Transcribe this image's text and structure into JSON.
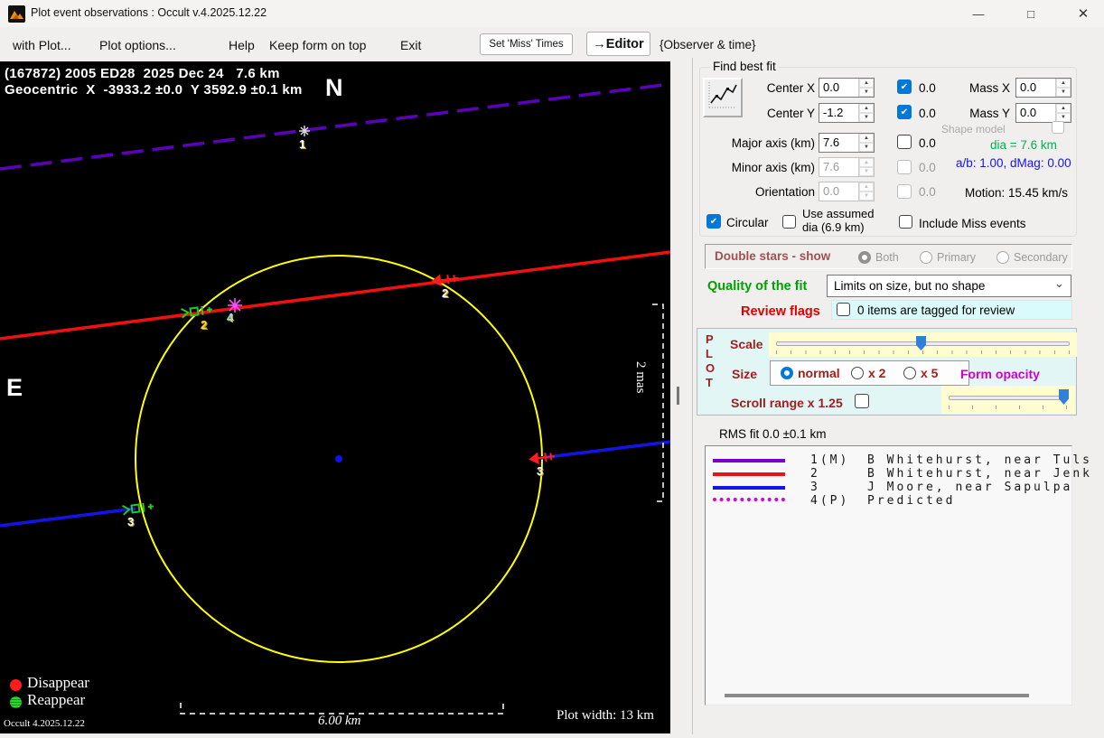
{
  "window": {
    "title": "Plot event observations : Occult v.4.2025.12.22"
  },
  "icons": {
    "minimize": "—",
    "maximize": "□",
    "close": "✕",
    "help": "?",
    "check": "✔",
    "spin_up": "▲",
    "spin_down": "▼",
    "dropdown": "⌄"
  },
  "menubar": {
    "with_plot": "with Plot...",
    "plot_options": "Plot options...",
    "help": "Help",
    "keep_on_top": "Keep form on top",
    "exit": "Exit",
    "set_miss_times": "Set 'Miss' Times",
    "editor": "→Editor",
    "observer_time": "{Observer & time}"
  },
  "plot": {
    "title": "(167872) 2005 ED28  2025 Dec 24   7.6 km",
    "subtitle": "Geocentric  X  -3933.2 ±0.0  Y 3592.9 ±0.1 km",
    "north": "N",
    "east": "E",
    "mas_bracket": "2 mas",
    "scalebar": "6.00 km",
    "plot_width": "Plot width: 13 km",
    "disappear": "Disappear",
    "reappear": "Reappear",
    "version": "Occult 4.2025.12.22",
    "markers": {
      "m1": "1",
      "m2_reappear": "2",
      "m2_disappear": "2",
      "m3_disappear": "3",
      "m3_reappear": "3",
      "m4": "4"
    },
    "colors": {
      "circle": "#ffff00",
      "center_dot": "#1313e8",
      "track1": "#5c00bc",
      "track2": "#f01010",
      "track3": "#1414e6",
      "predicted": "#dd00dd",
      "disappear": "#ff1c1c",
      "reappear": "#22cc22",
      "marker1": "#d8d8d8",
      "star4": "#ff4bff"
    }
  },
  "fit_panel": {
    "title": "Find best fit",
    "center_x": {
      "label": "Center X",
      "value": "0.0",
      "flag": "0.0"
    },
    "center_y": {
      "label": "Center Y",
      "value": "-1.2",
      "flag": "0.0"
    },
    "mass_x": {
      "label": "Mass X",
      "value": "0.0"
    },
    "mass_y": {
      "label": "Mass Y",
      "value": "0.0"
    },
    "shape_model": "Shape model",
    "major_axis": {
      "label": "Major axis (km)",
      "value": "7.6",
      "flag": "0.0"
    },
    "minor_axis": {
      "label": "Minor axis (km)",
      "value": "7.6",
      "flag": "0.0"
    },
    "orientation": {
      "label": "Orientation",
      "value": "0.0",
      "flag": "0.0"
    },
    "dia_text": "dia = 7.6 km",
    "ab_text": "a/b: 1.00, dMag: 0.00",
    "motion_text": "Motion: 15.45 km/s",
    "circular": "Circular",
    "use_assumed_1": "Use assumed",
    "use_assumed_2": "dia (6.9 km)",
    "include_miss": "Include Miss events"
  },
  "double_stars": {
    "label": "Double stars - show",
    "both": "Both",
    "primary": "Primary",
    "secondary": "Secondary"
  },
  "quality": {
    "label": "Quality of the fit",
    "value": "Limits on size, but no shape"
  },
  "review": {
    "label": "Review flags",
    "text": "0 items are tagged for review"
  },
  "plot_panel": {
    "p": "P",
    "l": "L",
    "o": "O",
    "t": "T",
    "scale": "Scale",
    "size": "Size",
    "normal": "normal",
    "x2": "x 2",
    "x5": "x 5",
    "form_opacity": "Form opacity",
    "scroll_range": "Scroll range x 1.25"
  },
  "rms": "RMS fit 0.0 ±0.1 km",
  "observers": [
    {
      "num": "1(M)",
      "name": "B Whitehurst, near Tuls",
      "color": "#7a00cc",
      "style": "solid"
    },
    {
      "num": "2",
      "name": "B Whitehurst, near Jenk",
      "color": "#ee1111",
      "style": "solid"
    },
    {
      "num": "3",
      "name": "J Moore, near Sapulpa",
      "color": "#1414e6",
      "style": "solid"
    },
    {
      "num": "4(P)",
      "name": "Predicted",
      "color": "#dd00dd",
      "style": "dotted"
    }
  ]
}
